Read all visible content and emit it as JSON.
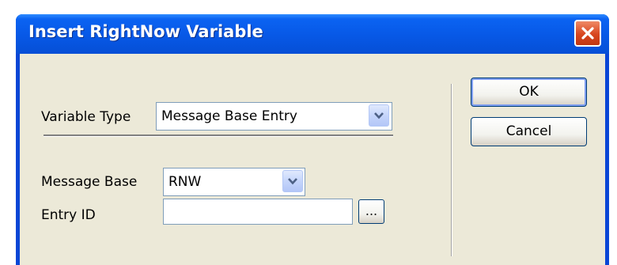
{
  "window": {
    "title": "Insert RightNow Variable",
    "close_icon": "close-x-icon"
  },
  "form": {
    "variable_type": {
      "label": "Variable Type",
      "value": "Message Base Entry"
    },
    "message_base": {
      "label": "Message Base",
      "value": "RNW"
    },
    "entry_id": {
      "label": "Entry ID",
      "value": "",
      "browse_label": "..."
    }
  },
  "buttons": {
    "ok_label": "OK",
    "cancel_label": "Cancel"
  },
  "colors": {
    "titlebar": "#0758e6",
    "client": "#ece9d8",
    "close_button": "#d8461f"
  }
}
